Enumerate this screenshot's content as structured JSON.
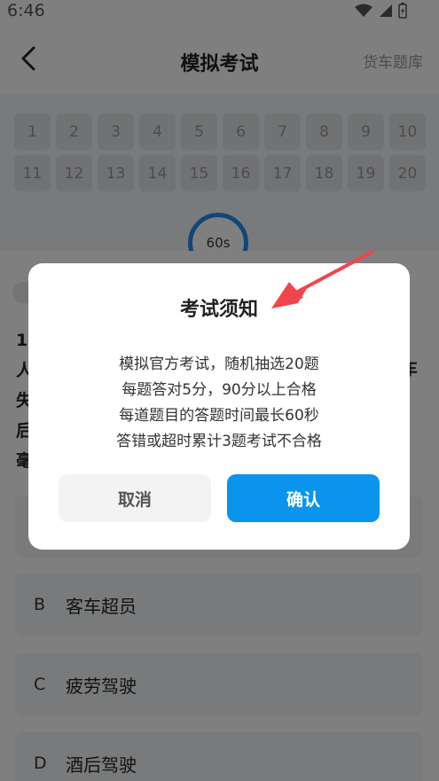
{
  "status_bar": {
    "time": "6:46",
    "tag": "cr4f"
  },
  "header": {
    "title": "模拟考试",
    "right_link": "货车题库"
  },
  "grid": {
    "numbers": [
      "1",
      "2",
      "3",
      "4",
      "5",
      "6",
      "7",
      "8",
      "9",
      "10",
      "11",
      "12",
      "13",
      "14",
      "15",
      "16",
      "17",
      "18",
      "19",
      "20"
    ]
  },
  "timer": {
    "label": "60s"
  },
  "question": {
    "lines": [
      "1.",
      "人",
      "失",
      "后",
      "毫"
    ],
    "right_fragments": [
      "车",
      "，"
    ]
  },
  "options": [
    {
      "letter": "",
      "text": ""
    },
    {
      "letter": "B",
      "text": "客车超员"
    },
    {
      "letter": "C",
      "text": "疲劳驾驶"
    },
    {
      "letter": "D",
      "text": "酒后驾驶"
    }
  ],
  "dialog": {
    "title": "考试须知",
    "lines": [
      "模拟官方考试，随机抽选20题",
      "每题答对5分，90分以上合格",
      "每道题目的答题时间最长60秒",
      "答错或超时累计3题考试不合格"
    ],
    "cancel_label": "取消",
    "confirm_label": "确认"
  },
  "colors": {
    "accent": "#0a94ee",
    "arrow": "#f0454d",
    "timer_ring": "#1e8ef0"
  }
}
